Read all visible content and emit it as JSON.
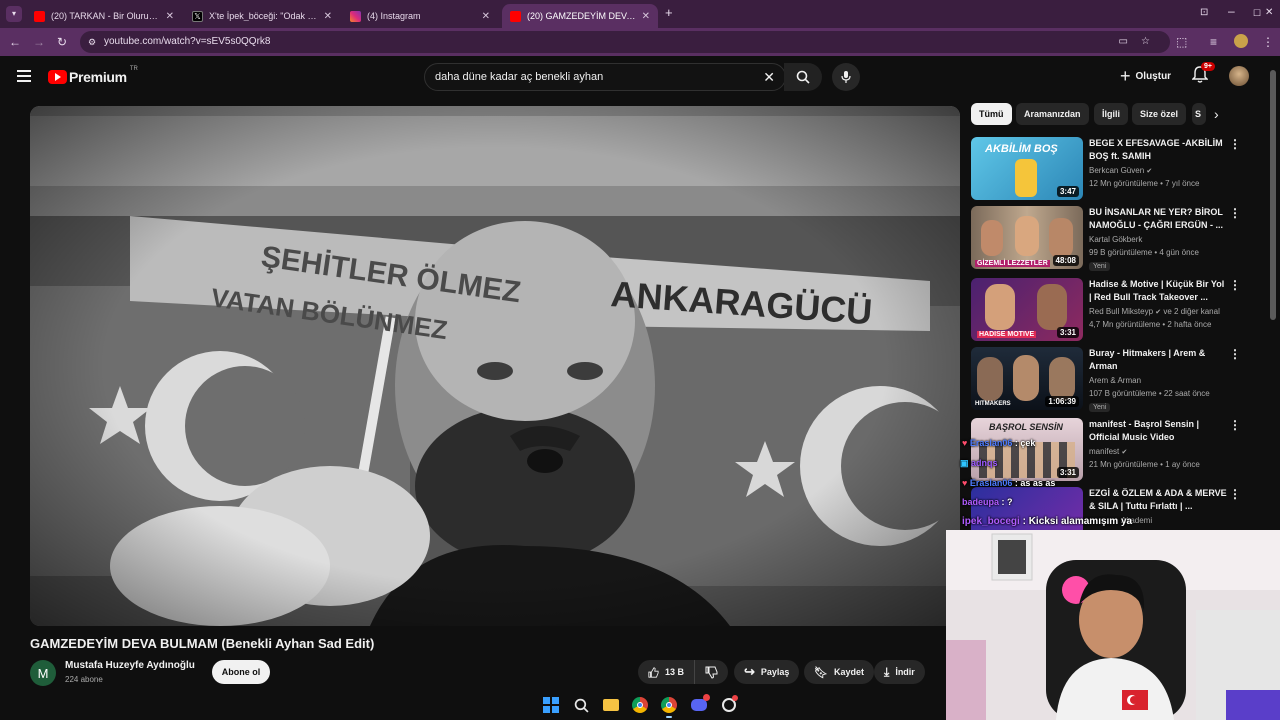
{
  "browser": {
    "tabs": [
      {
        "title": "(20) TARKAN - Bir Oluruz Yolun",
        "favicon_color": "#ff0000"
      },
      {
        "title": "X'te İpek_böceği: \"Odak çorapl",
        "favicon_color": "#000000"
      },
      {
        "title": "(4) Instagram",
        "favicon_color": "#d6249f"
      },
      {
        "title": "(20) GAMZEDEYİM DEVA BULM",
        "favicon_color": "#ff0000"
      }
    ],
    "url": "youtube.com/watch?v=sEV5s0QQrk8"
  },
  "youtube": {
    "logo_text": "Premium",
    "logo_region": "TR",
    "search_query": "daha düne kadar aç benekli ayhan",
    "create_label": "Oluştur",
    "notifications_badge": "9+"
  },
  "video": {
    "title": "GAMZEDEYİM DEVA BULMAM (Benekli Ayhan Sad Edit)",
    "channel_initial": "M",
    "channel_name": "Mustafa Huzeyfe Aydınoğlu",
    "subscribers": "224 abone",
    "subscribe_label": "Abone ol",
    "likes": "13 B",
    "share_label": "Paylaş",
    "save_label": "Kaydet",
    "download_label": "İndir"
  },
  "flags": {
    "scarf_left_line1": "ŞEHİTLER ÖLMEZ",
    "scarf_left_line2": "VATAN BÖLÜNMEZ",
    "scarf_right": "ANKARAGÜCÜ"
  },
  "chips": [
    "Tümü",
    "Aramanızdan",
    "İlgili",
    "Size özel",
    "S"
  ],
  "recommendations": [
    {
      "title": "BEGE X EFESAVAGE -AKBİLİM BOŞ ft. SAMIH",
      "channel": "Berkcan Güven",
      "verified": true,
      "meta": "12 Mn görüntüleme • 7 yıl önce",
      "duration": "3:47",
      "badge": "",
      "thumb_text": "AKBİLİM BOŞ"
    },
    {
      "title": "BU İNSANLAR NE YER? BİROL NAMOĞLU - ÇAĞRI ERGÜN - ...",
      "channel": "Kartal Gökberk",
      "verified": false,
      "meta": "99 B görüntüleme • 4 gün önce",
      "duration": "48:08",
      "badge": "Yeni",
      "thumb_text": "GİZEMLİ LEZZETLER"
    },
    {
      "title": "Hadise & Motive | Küçük Bir Yol | Red Bull Track Takeover ...",
      "channel": "Red Bull Mikstеyp",
      "verified": true,
      "channel_extra": "ve 2 diğer kanal",
      "meta": "4,7 Mn görüntüleme • 2 hafta önce",
      "duration": "3:31",
      "badge": "",
      "thumb_text": "HADISE MOTIVE"
    },
    {
      "title": "Buray - Hitmakers | Arem & Arman",
      "channel": "Arem & Arman",
      "verified": false,
      "meta": "107 B görüntüleme • 22 saat önce",
      "duration": "1:06:39",
      "badge": "Yeni",
      "thumb_text": "HITMAKERS"
    },
    {
      "title": "manifest - Başrol Sensin | Official Music Video",
      "channel": "manifest",
      "verified": true,
      "meta": "21 Mn görüntüleme • 1 ay önce",
      "duration": "3:31",
      "badge": "",
      "thumb_text": "BAŞROL SENSİN"
    },
    {
      "title": "EZGİ & ÖZLEM & ADA & MERVE & SILA | Tuttu Fırlattı | ...",
      "channel": "Akademi",
      "verified": false,
      "meta": "",
      "duration": "",
      "badge": "",
      "thumb_text": ""
    }
  ],
  "chat": [
    {
      "user": "Eraslan06",
      "text": ": çek",
      "color": "#4d7cff"
    },
    {
      "user": "adnqs",
      "text": "",
      "color": "#9b59ff"
    },
    {
      "user": "Eraslan06",
      "text": ": as as as",
      "color": "#4d7cff"
    },
    {
      "user": "badeupa",
      "text": ": ?",
      "color": "#b05cff"
    },
    {
      "user": "ipek_bocegi",
      "text": ": Kicksi alamamışım ya",
      "color": "#b05cff"
    }
  ],
  "colors": {
    "yt_red": "#ff0000",
    "browser_frame": "#5a2f62",
    "tab_strip": "#3a1e3f",
    "background": "#0f0f0f"
  }
}
